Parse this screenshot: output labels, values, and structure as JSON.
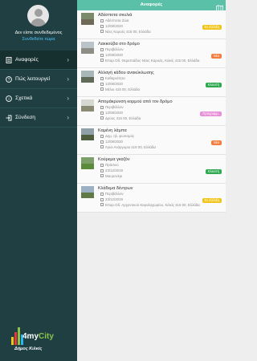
{
  "drawer": {
    "user_name": "Δεν είστε συνδεδεμένος",
    "login_link": "Συνδεθείτε τώρα",
    "menu": [
      {
        "label": "Αναφορές",
        "icon": "reports-icon",
        "active": true
      },
      {
        "label": "Πώς λειτουργεί",
        "icon": "help-icon",
        "active": false
      },
      {
        "label": "Σχετικά",
        "icon": "info-icon",
        "active": false
      },
      {
        "label": "Σύνδεση",
        "icon": "login-icon",
        "active": false
      }
    ],
    "logo_brand": "4my",
    "logo_city": "City",
    "logo_sub": "Δήμος Κιλκίς"
  },
  "header": {
    "title": "Αναφορές",
    "map_icon": "map-icon"
  },
  "reports": [
    {
      "title": "Αδέσποτα σκυλιά",
      "category": "Αδέσποτα Ζώα",
      "date": "12/08/2020",
      "address": "Νέες Καρυές 415 00, Ελλάδα",
      "status": "Σε εξέλιξη",
      "status_color": "#f0c419"
    },
    {
      "title": "Λακκούβα στο δρόμο",
      "category": "Περιβάλλον",
      "date": "12/08/2020",
      "address": "Επαρ.Οδ. Θεμιστιάδος-Νέας Καρυάς, Κιλκίς 415 00, Ελλάδα",
      "status": "Νέα",
      "status_color": "#f57c3c"
    },
    {
      "title": "Αλλαγή κάδου ανακύκλωσης",
      "category": "Καθαριότητα",
      "date": "12/08/2020",
      "address": "Μέλιο 415 00, Ελλάδα",
      "status": "Κλειστή",
      "status_color": "#2ea84e"
    },
    {
      "title": "Απομάκρυνση κορμού από τον δρόμο",
      "category": "Περιβάλλον",
      "date": "12/08/2020",
      "address": "Δρύος 415 00, Ελλάδα",
      "status": "Προγραμμ.",
      "status_color": "#e88fd8"
    },
    {
      "title": "Καμένη λάμπα",
      "category": "Δημ. ηλ. φωτισμός",
      "date": "12/08/2020",
      "address": "Άγιοι Ανάργυροι 415 00, Ελλάδα",
      "status": "Νέα",
      "status_color": "#f57c3c"
    },
    {
      "title": "Κούρεμα γκαζόν",
      "category": "Πράσινο",
      "date": "23/12/2019",
      "address": "Μαυρονέρι",
      "status": "Κλειστή",
      "status_color": "#2ea84e"
    },
    {
      "title": "Κλάδεμα δέντρων",
      "category": "Περιβάλλον",
      "date": "23/12/2019",
      "address": "Επαρ.Οδ. Αρχοντικού Κεφαλοχωρίου, Κιλκίς 415 00, Ελλάδα",
      "status": "Σε εξέλιξη",
      "status_color": "#f0c419"
    }
  ]
}
